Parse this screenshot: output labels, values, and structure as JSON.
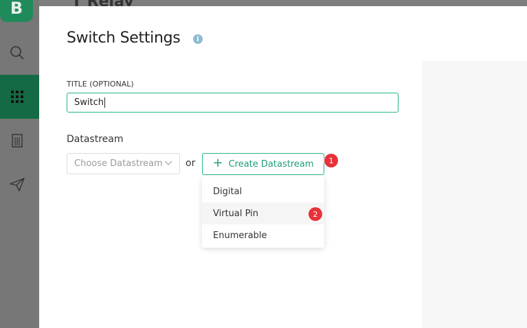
{
  "app": {
    "logo_letter": "B",
    "background_title": "T Relay",
    "sidebar_icons": [
      "search-icon",
      "grid-icon",
      "building-icon",
      "send-icon"
    ]
  },
  "modal": {
    "title": "Switch Settings",
    "info_icon": "i",
    "title_field": {
      "label": "TITLE (OPTIONAL)",
      "value": "Switch"
    },
    "datastream": {
      "label": "Datastream",
      "select_placeholder": "Choose Datastream",
      "or_text": "or",
      "create_button_label": "Create Datastream",
      "create_badge": "1",
      "menu_items": [
        "Digital",
        "Virtual Pin",
        "Enumerable"
      ],
      "virtual_pin_badge": "2"
    }
  },
  "colors": {
    "accent": "#23b48a",
    "brand_green": "#1f8a5a",
    "badge_red": "#e8323a"
  }
}
